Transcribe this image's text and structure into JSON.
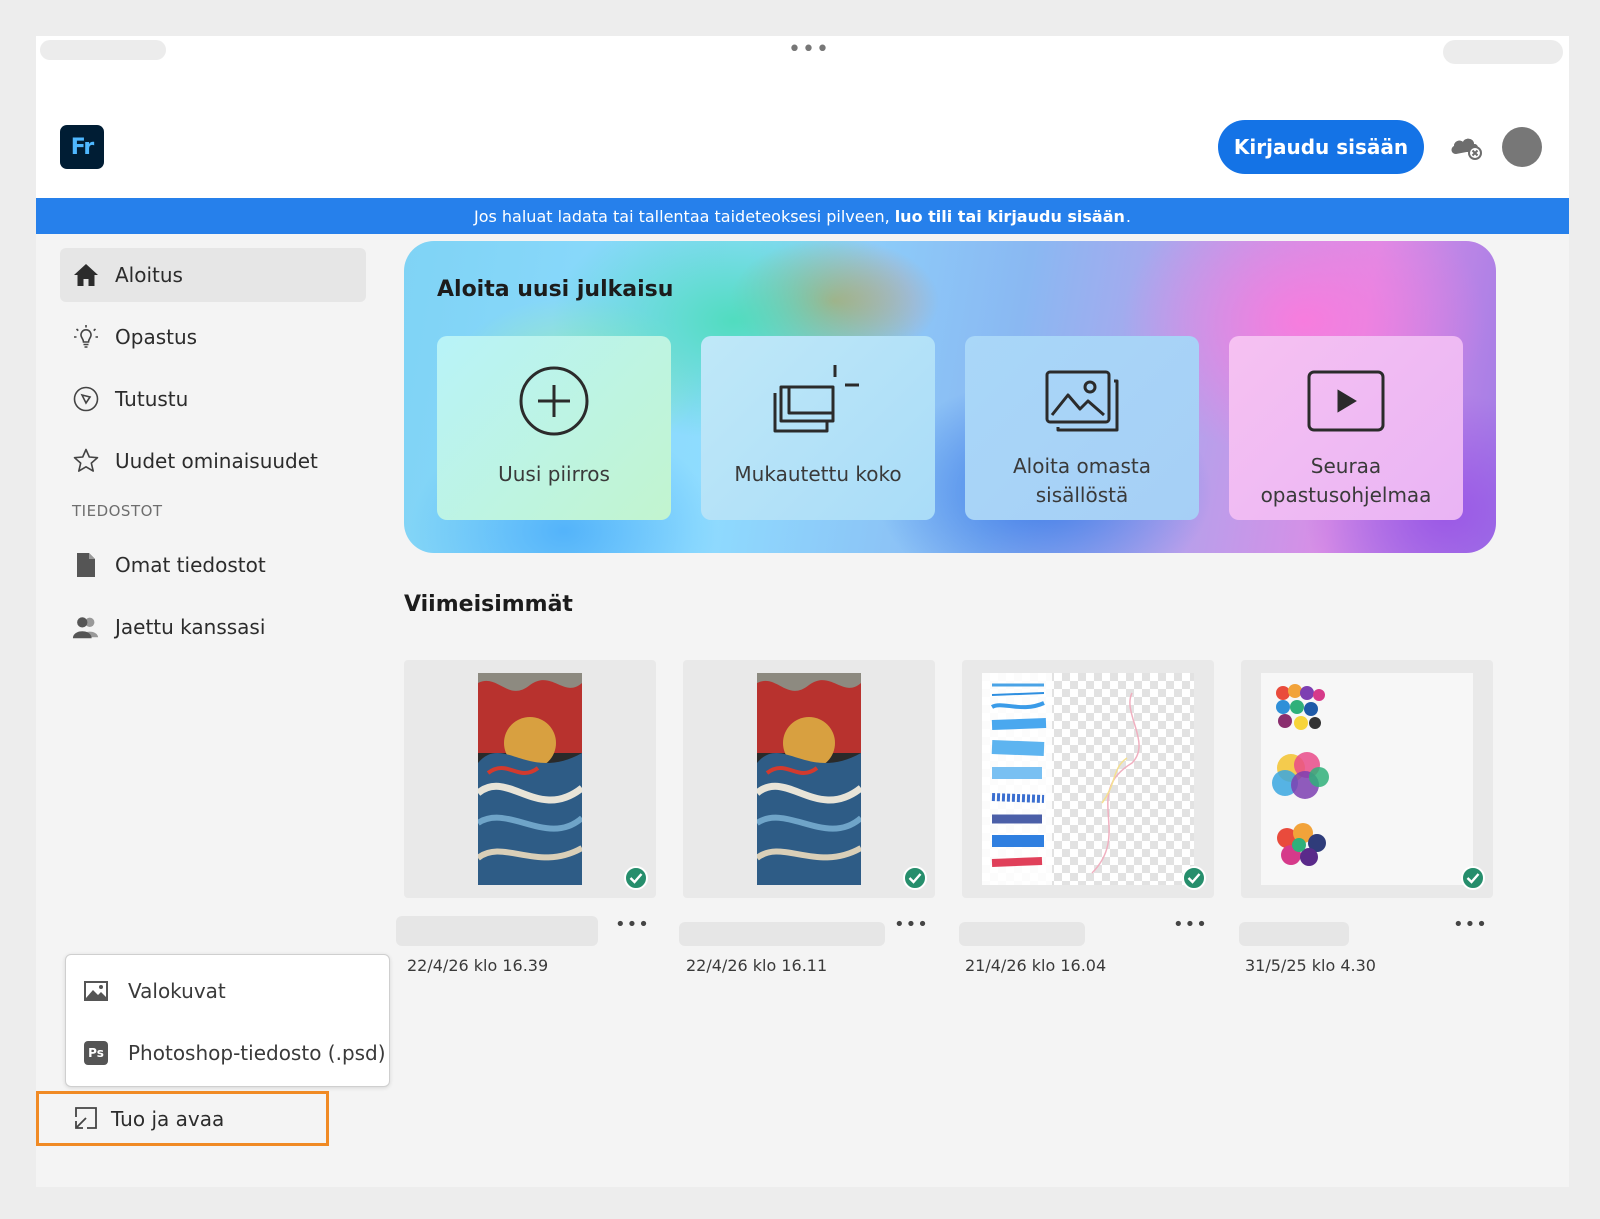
{
  "app": {
    "logo_text": "Fr",
    "signin_label": "Kirjaudu sisään"
  },
  "banner": {
    "text": "Jos haluat ladata tai tallentaa taideteoksesi pilveen,",
    "link": "luo tili tai kirjaudu sisään",
    "end": "."
  },
  "sidebar": {
    "items": [
      {
        "label": "Aloitus",
        "icon": "home-icon",
        "active": true
      },
      {
        "label": "Opastus",
        "icon": "lightbulb-icon"
      },
      {
        "label": "Tutustu",
        "icon": "compass-icon"
      },
      {
        "label": "Uudet ominaisuudet",
        "icon": "star-icon"
      }
    ],
    "section_files": "TIEDOSTOT",
    "file_items": [
      {
        "label": "Omat tiedostot",
        "icon": "file-icon"
      },
      {
        "label": "Jaettu kanssasi",
        "icon": "people-icon"
      }
    ]
  },
  "hero": {
    "title": "Aloita uusi julkaisu",
    "cards": [
      {
        "label": "Uusi piirros",
        "icon": "plus-circle-icon"
      },
      {
        "label": "Mukautettu koko",
        "icon": "custom-size-icon"
      },
      {
        "label": "Aloita omasta\nsisällöstä",
        "line1": "Aloita omasta",
        "line2": "sisällöstä",
        "icon": "image-icon"
      },
      {
        "label": "Seuraa\nopastusohjelmaa",
        "line1": "Seuraa",
        "line2": "opastusohjelmaa",
        "icon": "play-icon"
      }
    ]
  },
  "recents": {
    "title": "Viimeisimmät",
    "items": [
      {
        "date": "22/4/26 klo 16.39",
        "thumb": "wave-artwork"
      },
      {
        "date": "22/4/26 klo 16.11",
        "thumb": "wave-artwork"
      },
      {
        "date": "21/4/26 klo 16.04",
        "thumb": "brush-strokes"
      },
      {
        "date": "31/5/25 klo 4.30",
        "thumb": "color-swatches"
      }
    ]
  },
  "import_menu": {
    "items": [
      {
        "label": "Valokuvat",
        "icon": "photo-icon"
      },
      {
        "label": "Photoshop-tiedosto (.psd)",
        "icon": "ps-icon",
        "badge": "Ps"
      }
    ],
    "trigger_label": "Tuo ja avaa"
  },
  "colors": {
    "accent": "#1473e6",
    "banner": "#2680eb",
    "highlight": "#f08a24",
    "sync_ok": "#268e6c"
  }
}
